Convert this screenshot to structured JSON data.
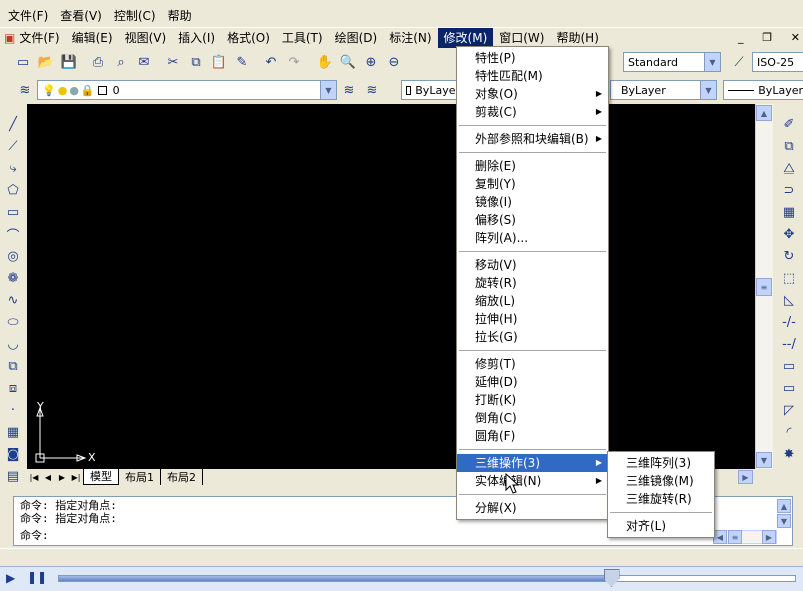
{
  "outer_menu": [
    "文件(F)",
    "查看(V)",
    "控制(C)",
    "帮助"
  ],
  "app_menu": [
    "文件(F)",
    "编辑(E)",
    "视图(V)",
    "插入(I)",
    "格式(O)",
    "工具(T)",
    "绘图(D)",
    "标注(N)",
    "修改(M)",
    "窗口(W)",
    "帮助(H)"
  ],
  "styles": {
    "text_style": "Standard",
    "dim_style": "ISO-25"
  },
  "layer": {
    "current": "0"
  },
  "properties": {
    "color": "ByLayer",
    "linetype": "ByLayer",
    "lineweight": "ByLayer"
  },
  "modify_menu": {
    "groups": [
      [
        {
          "label": "特性(P)"
        },
        {
          "label": "特性匹配(M)"
        },
        {
          "label": "对象(O)",
          "submenu": true
        },
        {
          "label": "剪裁(C)",
          "submenu": true
        }
      ],
      [
        {
          "label": "外部参照和块编辑(B)",
          "submenu": true
        }
      ],
      [
        {
          "label": "删除(E)"
        },
        {
          "label": "复制(Y)"
        },
        {
          "label": "镜像(I)"
        },
        {
          "label": "偏移(S)"
        },
        {
          "label": "阵列(A)..."
        }
      ],
      [
        {
          "label": "移动(V)"
        },
        {
          "label": "旋转(R)"
        },
        {
          "label": "缩放(L)"
        },
        {
          "label": "拉伸(H)"
        },
        {
          "label": "拉长(G)"
        }
      ],
      [
        {
          "label": "修剪(T)"
        },
        {
          "label": "延伸(D)"
        },
        {
          "label": "打断(K)"
        },
        {
          "label": "倒角(C)"
        },
        {
          "label": "圆角(F)"
        }
      ],
      [
        {
          "label": "三维操作(3)",
          "submenu": true,
          "highlighted": true
        },
        {
          "label": "实体编辑(N)",
          "submenu": true
        }
      ],
      [
        {
          "label": "分解(X)"
        }
      ]
    ]
  },
  "submenu_3d": {
    "items": [
      "三维阵列(3)",
      "三维镜像(M)",
      "三维旋转(R)"
    ],
    "extra": "对齐(L)"
  },
  "tabs": [
    "模型",
    "布局1",
    "布局2"
  ],
  "ucs": {
    "y_label": "Y",
    "x_label": "X"
  },
  "command_lines": [
    "命令: 指定对角点:",
    "命令: 指定对角点:",
    "命令:"
  ],
  "player": {
    "progress": 0.75
  }
}
